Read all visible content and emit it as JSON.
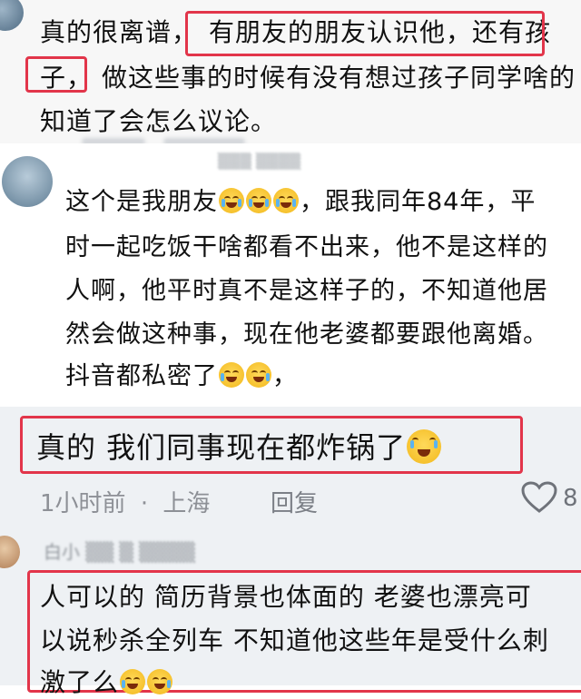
{
  "comment1": {
    "line1_a": "真的很离谱，",
    "line1_b": "有朋友的朋友认识他，还有孩",
    "line2_a": "子，",
    "line2_b": "做这些事的时候有没有想过孩子同学啥的",
    "line3": "知道了会怎么议论。"
  },
  "comment2": {
    "line1_a": "这个是我朋友",
    "line1_b": "，跟我同年84年，平",
    "line2": "时一起吃饭干啥都看不出来，他不是这样的",
    "line3": "人啊，他平时真不是这样子的，不知道他居",
    "line4": "然会做这种事，现在他老婆都要跟他离婚。",
    "line5_a": "抖音都私密了",
    "line5_b": "，",
    "emoji_names": [
      "loudly-crying-face",
      "grinning-face-with-sweat"
    ]
  },
  "comment3": {
    "text": "真的 我们同事现在都炸锅了",
    "time": "1小时前",
    "separator": "·",
    "location": "上海",
    "reply_label": "回复",
    "like_count_partial": "8"
  },
  "comment4": {
    "username_partial": "白小",
    "line1": "人可以的 简历背景也体面的 老婆也漂亮可",
    "line2": "以说秒杀全列车 不知道他这些年是受什么刺",
    "line3": "激了么"
  },
  "colors": {
    "highlight_border": "#e2354a",
    "meta_text": "#8d9096",
    "body_text": "#111111"
  }
}
